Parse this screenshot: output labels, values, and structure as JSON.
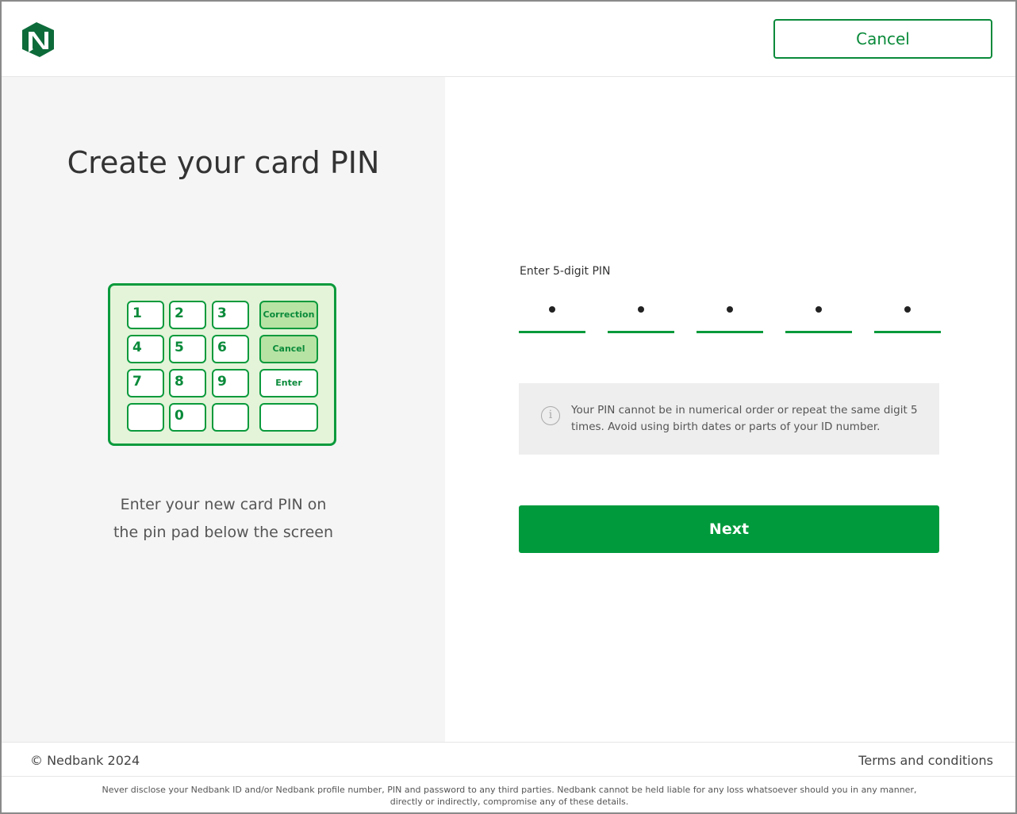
{
  "header": {
    "logo_icon": "nedbank-logo-icon",
    "cancel_label": "Cancel"
  },
  "left": {
    "title": "Create your card PIN",
    "pinpad": {
      "keys": [
        "1",
        "2",
        "3",
        "4",
        "5",
        "6",
        "7",
        "8",
        "9",
        "",
        "0",
        ""
      ],
      "function_keys": [
        "Correction",
        "Cancel",
        "Enter",
        ""
      ]
    },
    "instruction_line1": "Enter your new card PIN on",
    "instruction_line2": "the pin pad below the screen"
  },
  "pin": {
    "label": "Enter 5-digit PIN",
    "digits_entered": 5,
    "digits_total": 5
  },
  "info": {
    "icon": "info-icon",
    "text": "Your PIN cannot be in numerical order or repeat the same digit 5 times. Avoid using birth dates or parts of your ID number."
  },
  "next_label": "Next",
  "footer": {
    "copyright": "© Nedbank 2024",
    "terms": "Terms and conditions",
    "disclaimer": "Never disclose your Nedbank ID and/or Nedbank profile number, PIN and password to any third parties. Nedbank cannot be held liable for any loss whatsoever should you in any manner, directly or indirectly, compromise any of these details."
  },
  "colors": {
    "brand_green": "#009a3c",
    "pinpad_bg": "#e4f4d9",
    "pinpad_key_highlight": "#b7e3a4"
  }
}
